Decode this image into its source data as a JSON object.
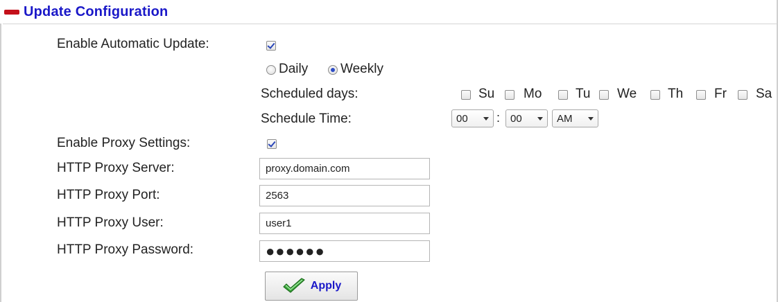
{
  "section": {
    "title": "Update Configuration",
    "icon": "collapse-minus-icon",
    "title_color": "#1a18c8",
    "icon_color": "#c4101a"
  },
  "auto_update": {
    "label": "Enable Automatic Update:",
    "checked": true,
    "frequency": {
      "options": [
        "Daily",
        "Weekly"
      ],
      "selected": "Weekly"
    },
    "scheduled_days": {
      "label": "Scheduled days:",
      "days": [
        {
          "label": "Su",
          "checked": false
        },
        {
          "label": "Mo",
          "checked": false
        },
        {
          "label": "Tu",
          "checked": false
        },
        {
          "label": "We",
          "checked": false
        },
        {
          "label": "Th",
          "checked": false
        },
        {
          "label": "Fr",
          "checked": false
        },
        {
          "label": "Sa",
          "checked": false
        }
      ]
    },
    "schedule_time": {
      "label": "Schedule Time:",
      "hour": "00",
      "separator": ":",
      "minute": "00",
      "ampm": "AM"
    }
  },
  "proxy": {
    "enable_label": "Enable Proxy Settings:",
    "enabled": true,
    "server_label": "HTTP Proxy Server:",
    "server_value": "proxy.domain.com",
    "port_label": "HTTP Proxy Port:",
    "port_value": "2563",
    "user_label": "HTTP Proxy User:",
    "user_value": "user1",
    "password_label": "HTTP Proxy Password:",
    "password_value": "●●●●●●"
  },
  "actions": {
    "apply_label": "Apply",
    "apply_icon": "checkmark-icon"
  }
}
